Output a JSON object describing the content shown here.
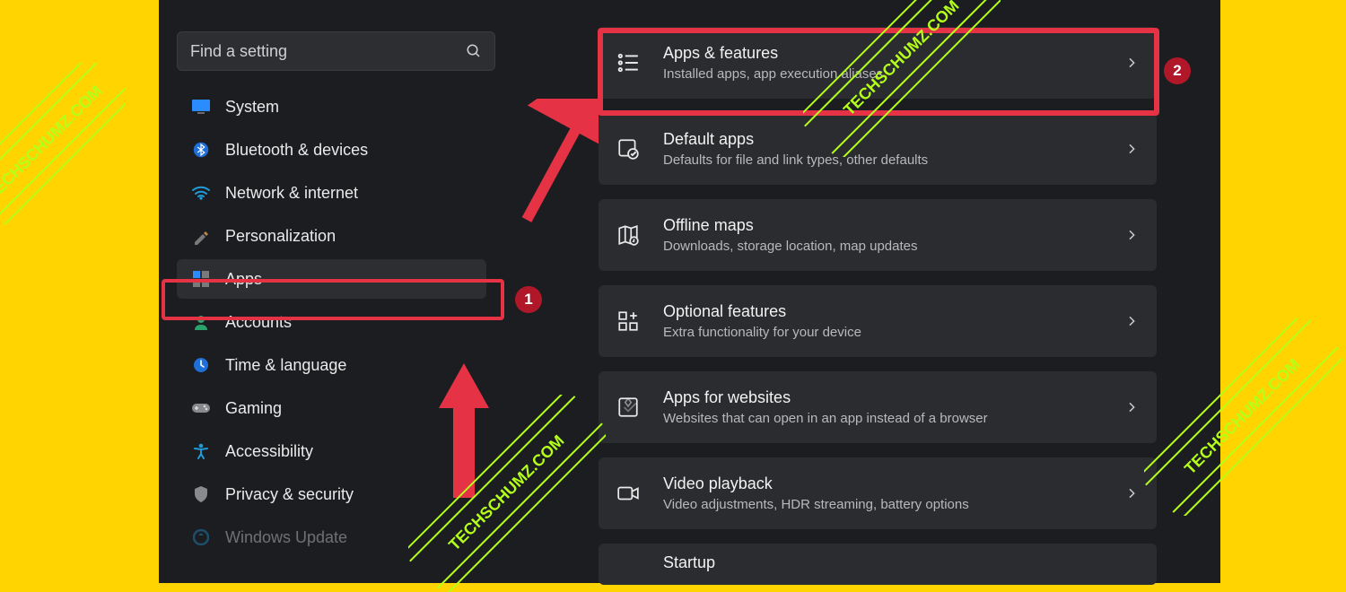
{
  "search": {
    "placeholder": "Find a setting"
  },
  "sidebar": {
    "items": [
      {
        "label": "System"
      },
      {
        "label": "Bluetooth & devices"
      },
      {
        "label": "Network & internet"
      },
      {
        "label": "Personalization"
      },
      {
        "label": "Apps"
      },
      {
        "label": "Accounts"
      },
      {
        "label": "Time & language"
      },
      {
        "label": "Gaming"
      },
      {
        "label": "Accessibility"
      },
      {
        "label": "Privacy & security"
      },
      {
        "label": "Windows Update"
      }
    ]
  },
  "main": {
    "cards": [
      {
        "title": "Apps & features",
        "sub": "Installed apps, app execution aliases"
      },
      {
        "title": "Default apps",
        "sub": "Defaults for file and link types, other defaults"
      },
      {
        "title": "Offline maps",
        "sub": "Downloads, storage location, map updates"
      },
      {
        "title": "Optional features",
        "sub": "Extra functionality for your device"
      },
      {
        "title": "Apps for websites",
        "sub": "Websites that can open in an app instead of a browser"
      },
      {
        "title": "Video playback",
        "sub": "Video adjustments, HDR streaming, battery options"
      },
      {
        "title": "Startup",
        "sub": ""
      }
    ]
  },
  "annotations": {
    "badge1": "1",
    "badge2": "2"
  },
  "watermark_text": "TECHSCHUMZ.COM"
}
